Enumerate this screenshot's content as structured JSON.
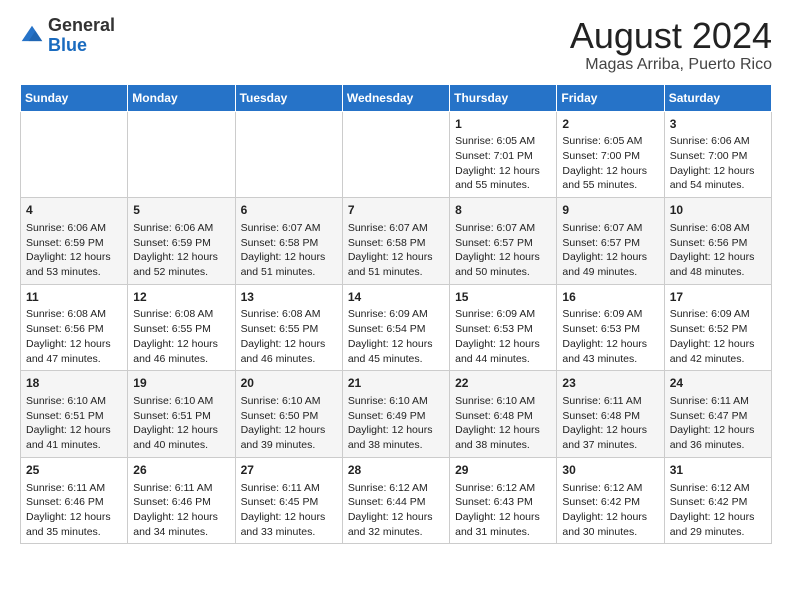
{
  "logo": {
    "general": "General",
    "blue": "Blue"
  },
  "title": "August 2024",
  "subtitle": "Magas Arriba, Puerto Rico",
  "days_header": [
    "Sunday",
    "Monday",
    "Tuesday",
    "Wednesday",
    "Thursday",
    "Friday",
    "Saturday"
  ],
  "weeks": [
    [
      {
        "day": "",
        "info": ""
      },
      {
        "day": "",
        "info": ""
      },
      {
        "day": "",
        "info": ""
      },
      {
        "day": "",
        "info": ""
      },
      {
        "day": "1",
        "info": "Sunrise: 6:05 AM\nSunset: 7:01 PM\nDaylight: 12 hours\nand 55 minutes."
      },
      {
        "day": "2",
        "info": "Sunrise: 6:05 AM\nSunset: 7:00 PM\nDaylight: 12 hours\nand 55 minutes."
      },
      {
        "day": "3",
        "info": "Sunrise: 6:06 AM\nSunset: 7:00 PM\nDaylight: 12 hours\nand 54 minutes."
      }
    ],
    [
      {
        "day": "4",
        "info": "Sunrise: 6:06 AM\nSunset: 6:59 PM\nDaylight: 12 hours\nand 53 minutes."
      },
      {
        "day": "5",
        "info": "Sunrise: 6:06 AM\nSunset: 6:59 PM\nDaylight: 12 hours\nand 52 minutes."
      },
      {
        "day": "6",
        "info": "Sunrise: 6:07 AM\nSunset: 6:58 PM\nDaylight: 12 hours\nand 51 minutes."
      },
      {
        "day": "7",
        "info": "Sunrise: 6:07 AM\nSunset: 6:58 PM\nDaylight: 12 hours\nand 51 minutes."
      },
      {
        "day": "8",
        "info": "Sunrise: 6:07 AM\nSunset: 6:57 PM\nDaylight: 12 hours\nand 50 minutes."
      },
      {
        "day": "9",
        "info": "Sunrise: 6:07 AM\nSunset: 6:57 PM\nDaylight: 12 hours\nand 49 minutes."
      },
      {
        "day": "10",
        "info": "Sunrise: 6:08 AM\nSunset: 6:56 PM\nDaylight: 12 hours\nand 48 minutes."
      }
    ],
    [
      {
        "day": "11",
        "info": "Sunrise: 6:08 AM\nSunset: 6:56 PM\nDaylight: 12 hours\nand 47 minutes."
      },
      {
        "day": "12",
        "info": "Sunrise: 6:08 AM\nSunset: 6:55 PM\nDaylight: 12 hours\nand 46 minutes."
      },
      {
        "day": "13",
        "info": "Sunrise: 6:08 AM\nSunset: 6:55 PM\nDaylight: 12 hours\nand 46 minutes."
      },
      {
        "day": "14",
        "info": "Sunrise: 6:09 AM\nSunset: 6:54 PM\nDaylight: 12 hours\nand 45 minutes."
      },
      {
        "day": "15",
        "info": "Sunrise: 6:09 AM\nSunset: 6:53 PM\nDaylight: 12 hours\nand 44 minutes."
      },
      {
        "day": "16",
        "info": "Sunrise: 6:09 AM\nSunset: 6:53 PM\nDaylight: 12 hours\nand 43 minutes."
      },
      {
        "day": "17",
        "info": "Sunrise: 6:09 AM\nSunset: 6:52 PM\nDaylight: 12 hours\nand 42 minutes."
      }
    ],
    [
      {
        "day": "18",
        "info": "Sunrise: 6:10 AM\nSunset: 6:51 PM\nDaylight: 12 hours\nand 41 minutes."
      },
      {
        "day": "19",
        "info": "Sunrise: 6:10 AM\nSunset: 6:51 PM\nDaylight: 12 hours\nand 40 minutes."
      },
      {
        "day": "20",
        "info": "Sunrise: 6:10 AM\nSunset: 6:50 PM\nDaylight: 12 hours\nand 39 minutes."
      },
      {
        "day": "21",
        "info": "Sunrise: 6:10 AM\nSunset: 6:49 PM\nDaylight: 12 hours\nand 38 minutes."
      },
      {
        "day": "22",
        "info": "Sunrise: 6:10 AM\nSunset: 6:48 PM\nDaylight: 12 hours\nand 38 minutes."
      },
      {
        "day": "23",
        "info": "Sunrise: 6:11 AM\nSunset: 6:48 PM\nDaylight: 12 hours\nand 37 minutes."
      },
      {
        "day": "24",
        "info": "Sunrise: 6:11 AM\nSunset: 6:47 PM\nDaylight: 12 hours\nand 36 minutes."
      }
    ],
    [
      {
        "day": "25",
        "info": "Sunrise: 6:11 AM\nSunset: 6:46 PM\nDaylight: 12 hours\nand 35 minutes."
      },
      {
        "day": "26",
        "info": "Sunrise: 6:11 AM\nSunset: 6:46 PM\nDaylight: 12 hours\nand 34 minutes."
      },
      {
        "day": "27",
        "info": "Sunrise: 6:11 AM\nSunset: 6:45 PM\nDaylight: 12 hours\nand 33 minutes."
      },
      {
        "day": "28",
        "info": "Sunrise: 6:12 AM\nSunset: 6:44 PM\nDaylight: 12 hours\nand 32 minutes."
      },
      {
        "day": "29",
        "info": "Sunrise: 6:12 AM\nSunset: 6:43 PM\nDaylight: 12 hours\nand 31 minutes."
      },
      {
        "day": "30",
        "info": "Sunrise: 6:12 AM\nSunset: 6:42 PM\nDaylight: 12 hours\nand 30 minutes."
      },
      {
        "day": "31",
        "info": "Sunrise: 6:12 AM\nSunset: 6:42 PM\nDaylight: 12 hours\nand 29 minutes."
      }
    ]
  ]
}
